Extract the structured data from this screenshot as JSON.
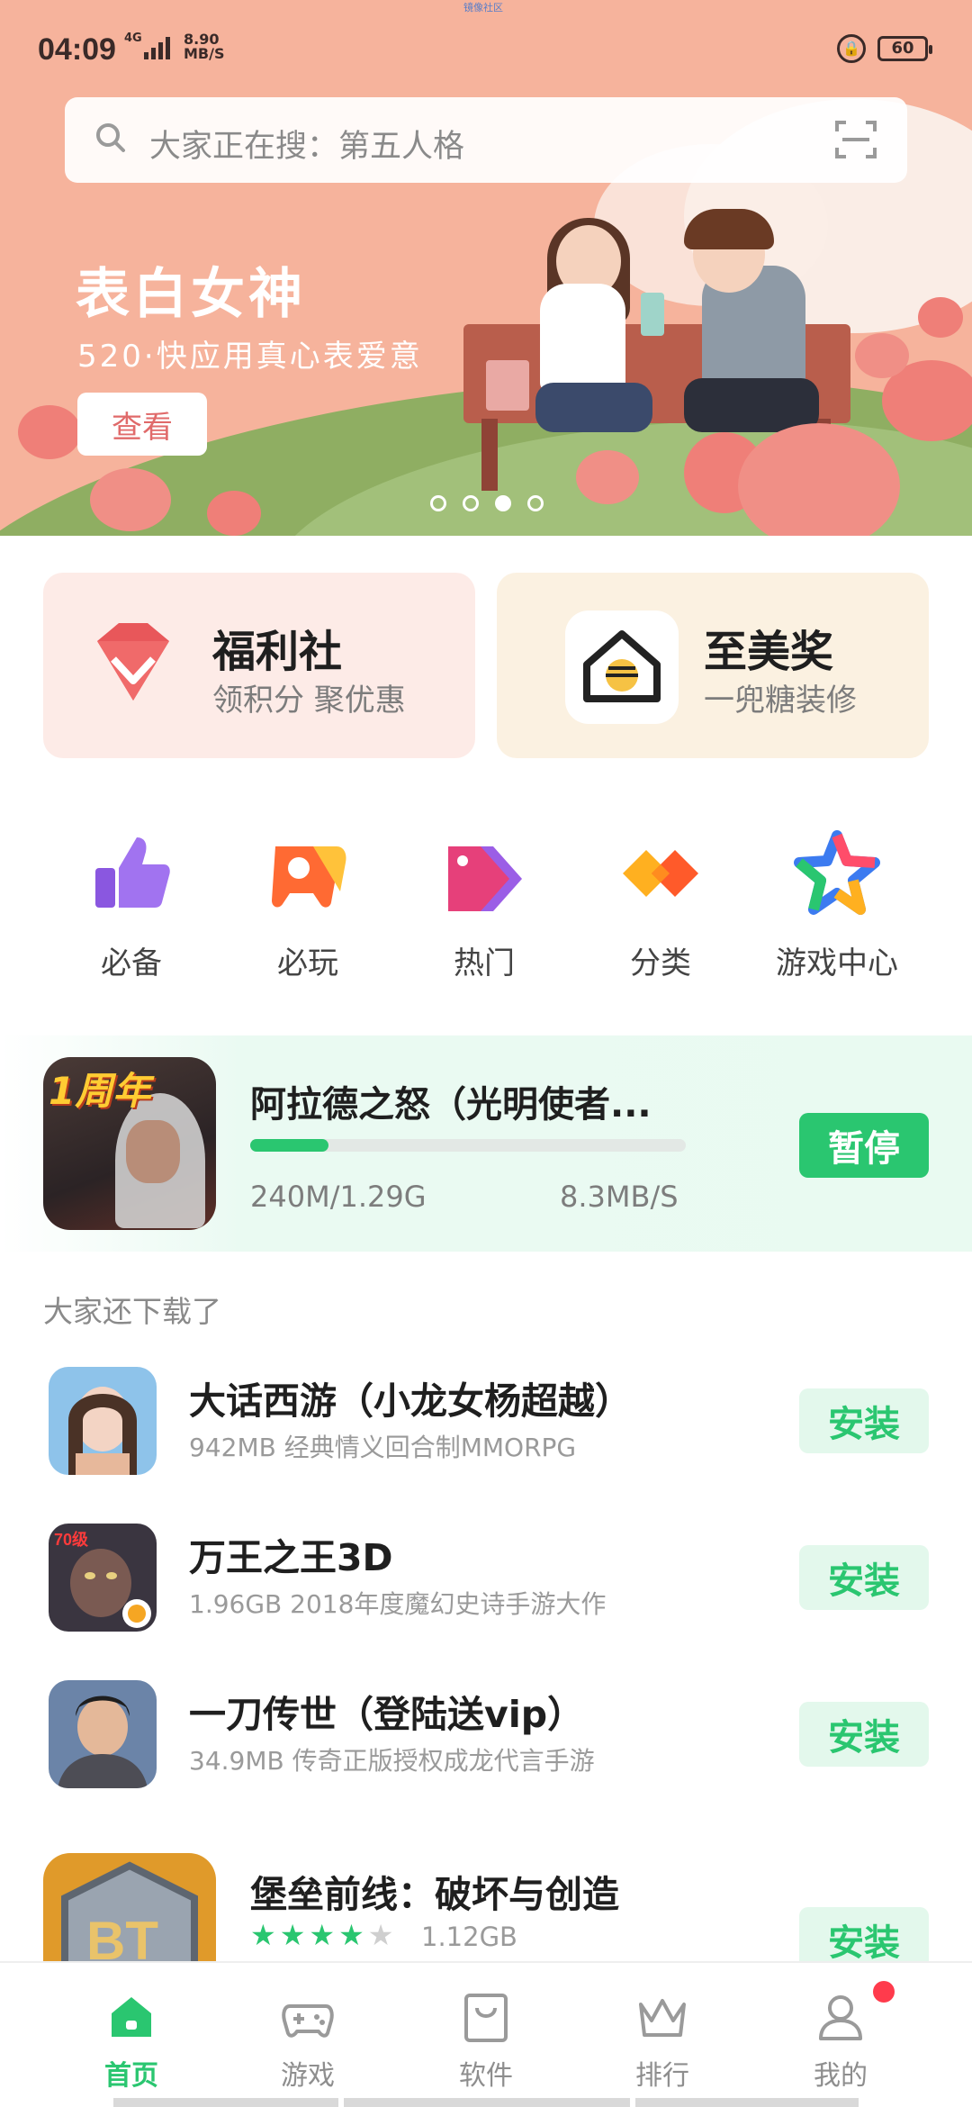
{
  "status_bar": {
    "time": "04:09",
    "network": "4G",
    "speed_value": "8.90",
    "speed_unit": "MB/S",
    "battery": "60",
    "top_tiny_text": "镜像社区"
  },
  "search": {
    "placeholder": "大家正在搜：第五人格"
  },
  "banner": {
    "title": "表白女神",
    "subtitle": "520·快应用真心表爱意",
    "button_label": "查看",
    "active_dot": 3,
    "dot_count": 4
  },
  "cards": [
    {
      "title": "福利社",
      "subtitle": "领积分 聚优惠",
      "icon": "diamond-icon"
    },
    {
      "title": "至美奖",
      "subtitle": "一兜糖装修",
      "icon": "house-icon"
    }
  ],
  "categories": [
    {
      "label": "必备",
      "icon": "thumbs-up-icon",
      "color": "#9a63e8"
    },
    {
      "label": "必玩",
      "icon": "gamepad-icon",
      "color": "#ff7a2f"
    },
    {
      "label": "热门",
      "icon": "tag-icon",
      "color": "#e0447a"
    },
    {
      "label": "分类",
      "icon": "category-icon",
      "color": "#ff9a1f"
    },
    {
      "label": "游戏中心",
      "icon": "star-icon",
      "color": "#3c7bf0"
    }
  ],
  "downloading": {
    "title": "阿拉德之怒（光明使者...",
    "badge": "1周年",
    "progress": 0.18,
    "size": "240M/1.29G",
    "speed": "8.3MB/S",
    "button_label": "暂停"
  },
  "section_title": "大家还下载了",
  "apps": [
    {
      "name": "大话西游（小龙女杨超越）",
      "desc": "942MB  经典情义回合制MMORPG",
      "button": "安装"
    },
    {
      "name": "万王之王3D",
      "desc": "1.96GB  2018年度魔幻史诗手游大作",
      "button": "安装"
    },
    {
      "name": "一刀传世（登陆送vip）",
      "desc": "34.9MB  传奇正版授权成龙代言手游",
      "button": "安装"
    },
    {
      "name": "堡垒前线：破坏与创造",
      "size": "1.12GB",
      "rating": 4,
      "rating_max": 5,
      "button": "安装"
    }
  ],
  "nav": [
    {
      "label": "首页",
      "icon": "home-icon",
      "active": true
    },
    {
      "label": "游戏",
      "icon": "gamepad-icon",
      "active": false
    },
    {
      "label": "软件",
      "icon": "bag-icon",
      "active": false
    },
    {
      "label": "排行",
      "icon": "crown-icon",
      "active": false
    },
    {
      "label": "我的",
      "icon": "user-icon",
      "active": false
    }
  ],
  "colors": {
    "accent": "#2ac670",
    "accent_light": "#e3f8ec",
    "banner": "#f6b39c",
    "card_left": "#fdebe7",
    "card_right": "#fbf1e1",
    "badge_red": "#ff3b4c"
  }
}
